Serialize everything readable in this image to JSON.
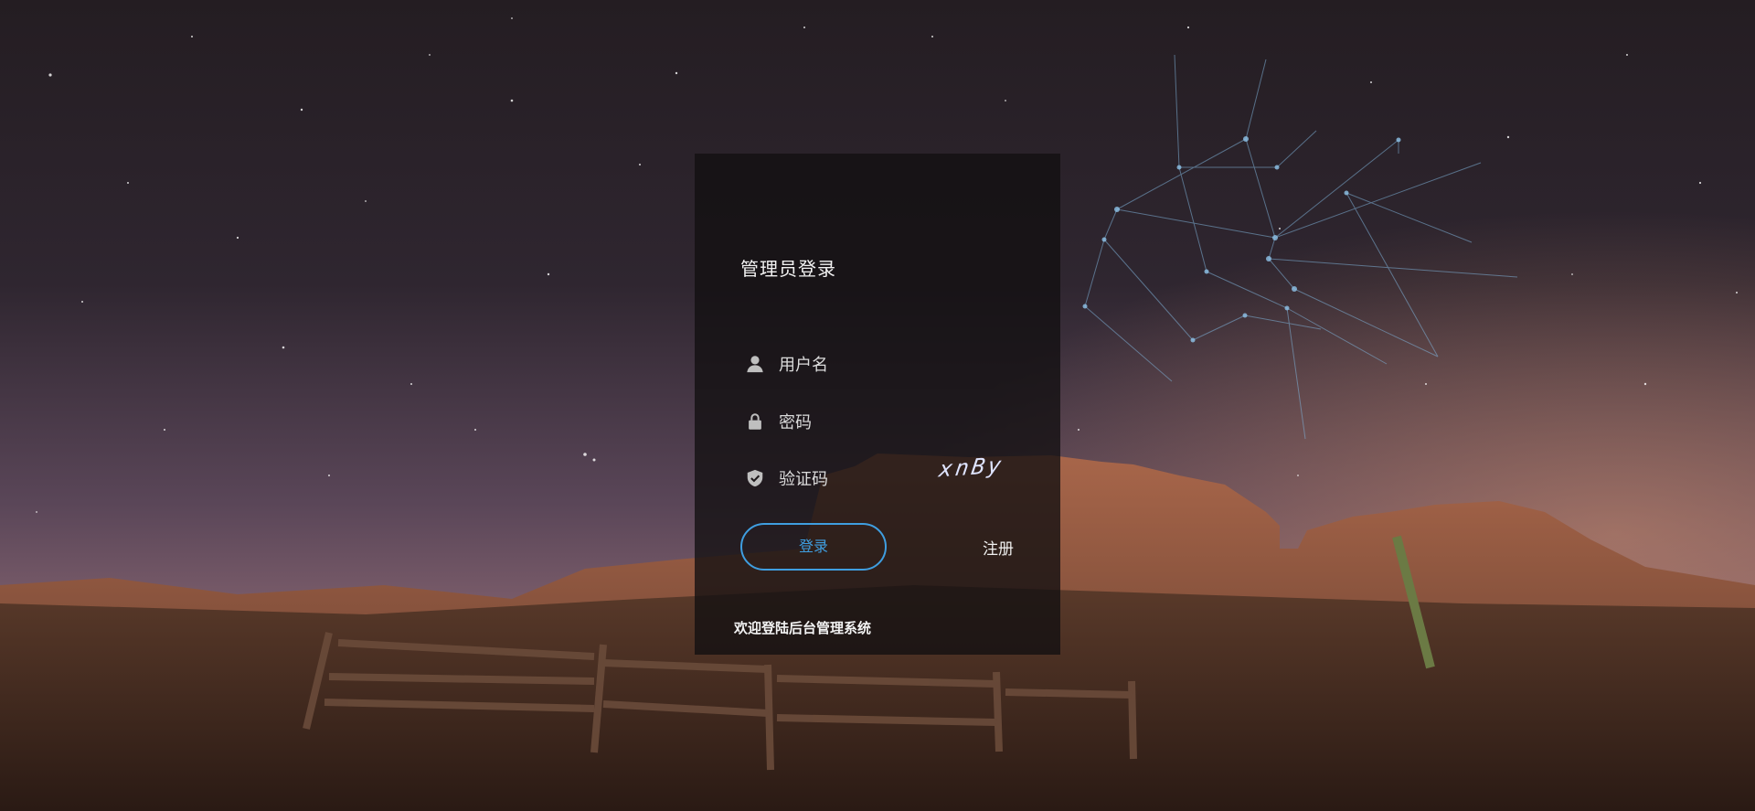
{
  "login": {
    "title": "管理员登录",
    "username": {
      "placeholder": "用户名",
      "value": ""
    },
    "password": {
      "placeholder": "密码",
      "value": ""
    },
    "captcha": {
      "placeholder": "验证码",
      "value": "",
      "image_text": "xnBy"
    },
    "login_label": "登录",
    "register_label": "注册",
    "welcome": "欢迎登陆后台管理系统"
  },
  "icons": {
    "username": "user-icon",
    "password": "lock-icon",
    "captcha": "shield-check-icon"
  },
  "colors": {
    "accent": "#3f9ee0",
    "panel": "#141113",
    "text": "#f2f2f2"
  }
}
